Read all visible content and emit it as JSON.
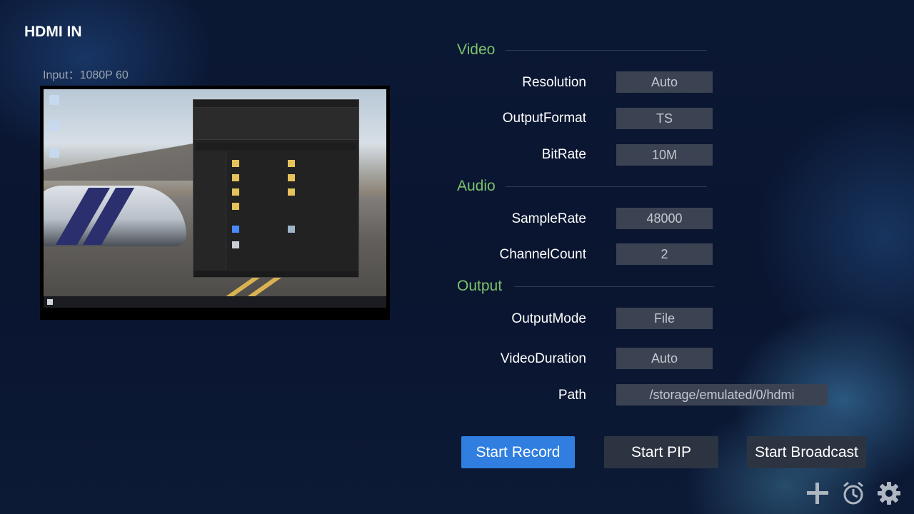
{
  "app": {
    "title": "HDMI IN",
    "input_info": "Input：1080P 60"
  },
  "preview": {
    "description_icon_names": [
      "desktop-wallpaper",
      "file-explorer-window",
      "taskbar"
    ]
  },
  "sections": {
    "video": "Video",
    "audio": "Audio",
    "output": "Output"
  },
  "settings": {
    "resolution": {
      "label": "Resolution",
      "value": "Auto"
    },
    "output_format": {
      "label": "OutputFormat",
      "value": "TS"
    },
    "bit_rate": {
      "label": "BitRate",
      "value": "10M"
    },
    "sample_rate": {
      "label": "SampleRate",
      "value": "48000"
    },
    "channel_count": {
      "label": "ChannelCount",
      "value": "2"
    },
    "output_mode": {
      "label": "OutputMode",
      "value": "File"
    },
    "video_duration": {
      "label": "VideoDuration",
      "value": "Auto"
    },
    "path": {
      "label": "Path",
      "value": "/storage/emulated/0/hdmi"
    }
  },
  "buttons": {
    "start_record": "Start Record",
    "start_pip": "Start PIP",
    "start_broadcast": "Start Broadcast"
  },
  "icons": {
    "add": "plus-icon",
    "timer": "alarm-clock-icon",
    "settings": "gear-icon"
  },
  "colors": {
    "accent": "#2f7ee0",
    "section_title": "#7cc36c",
    "field_bg": "#3b4352"
  }
}
